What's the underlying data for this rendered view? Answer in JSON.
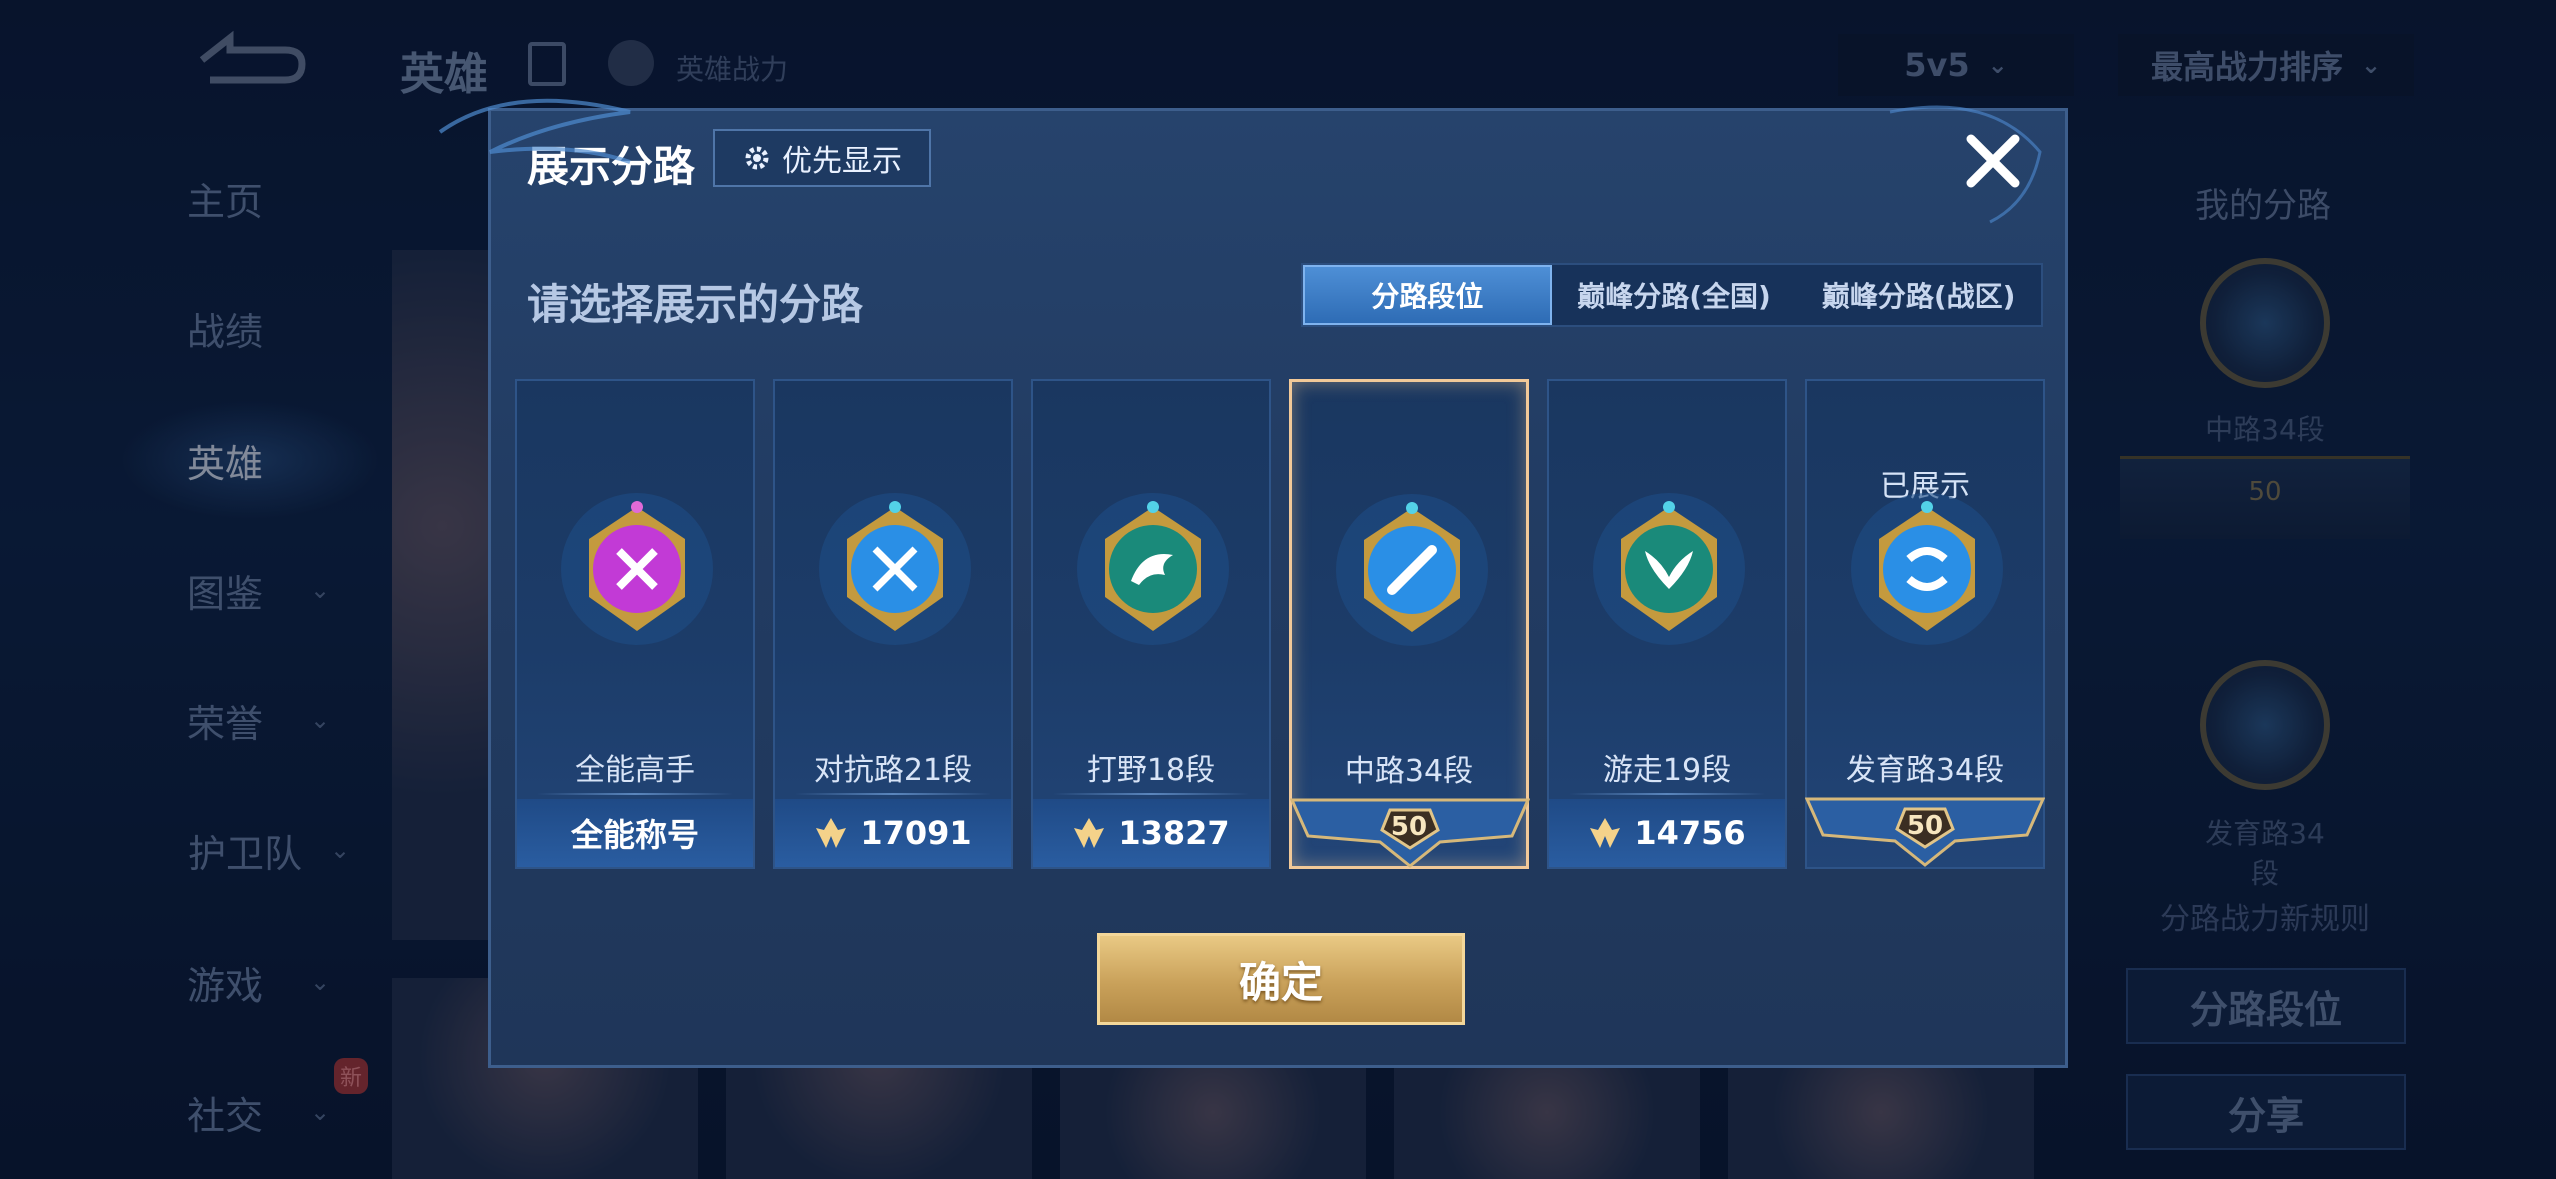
{
  "background": {
    "top_title": "英雄",
    "top_power_label": "英雄战力",
    "mode_select": "5v5",
    "sort_select": "最高战力排序",
    "sidebar_items": [
      {
        "label": "主页",
        "has_chevron": false
      },
      {
        "label": "战绩",
        "has_chevron": false
      },
      {
        "label": "英雄",
        "has_chevron": false,
        "active": true
      },
      {
        "label": "图鉴",
        "has_chevron": true
      },
      {
        "label": "荣誉",
        "has_chevron": true
      },
      {
        "label": "护卫队",
        "has_chevron": true
      },
      {
        "label": "游戏",
        "has_chevron": true
      },
      {
        "label": "社交",
        "has_chevron": true
      }
    ],
    "new_badge": "新",
    "right_panel": {
      "title": "我的分路",
      "badge1_label": "中路34段",
      "badge1_level": "50",
      "badge2_label": "发育路34段",
      "rule_text": "分路战力新规则",
      "lane_rank_button": "分路段位",
      "share_button": "分享"
    }
  },
  "modal": {
    "title": "展示分路",
    "priority_button": "优先显示",
    "subtitle": "请选择展示的分路",
    "tabs": [
      {
        "label": "分路段位",
        "active": true
      },
      {
        "label": "巅峰分路(全国)",
        "active": false
      },
      {
        "label": "巅峰分路(战区)",
        "active": false
      }
    ],
    "cards": [
      {
        "name": "全能高手",
        "bottom_type": "text",
        "bottom_text": "全能称号",
        "emblem": "allround-emblem-icon",
        "emblem_color": "#c23ad6",
        "selected": false,
        "shown": false
      },
      {
        "name": "对抗路21段",
        "bottom_type": "score",
        "bottom_text": "17091",
        "emblem": "clash-lane-emblem-icon",
        "emblem_color": "#2a8fe6",
        "selected": false,
        "shown": false
      },
      {
        "name": "打野18段",
        "bottom_type": "score",
        "bottom_text": "13827",
        "emblem": "jungle-emblem-icon",
        "emblem_color": "#1a8a7a",
        "selected": false,
        "shown": false
      },
      {
        "name": "中路34段",
        "bottom_type": "level",
        "bottom_text": "50",
        "emblem": "mid-lane-emblem-icon",
        "emblem_color": "#2a8fe6",
        "selected": true,
        "shown": false
      },
      {
        "name": "游走19段",
        "bottom_type": "score",
        "bottom_text": "14756",
        "emblem": "roam-emblem-icon",
        "emblem_color": "#1a8a7a",
        "selected": false,
        "shown": false
      },
      {
        "name": "发育路34段",
        "bottom_type": "level",
        "bottom_text": "50",
        "emblem": "farm-lane-emblem-icon",
        "emblem_color": "#2a8fe6",
        "selected": false,
        "shown": true,
        "shown_label": "已展示"
      }
    ],
    "confirm_button": "确定"
  }
}
